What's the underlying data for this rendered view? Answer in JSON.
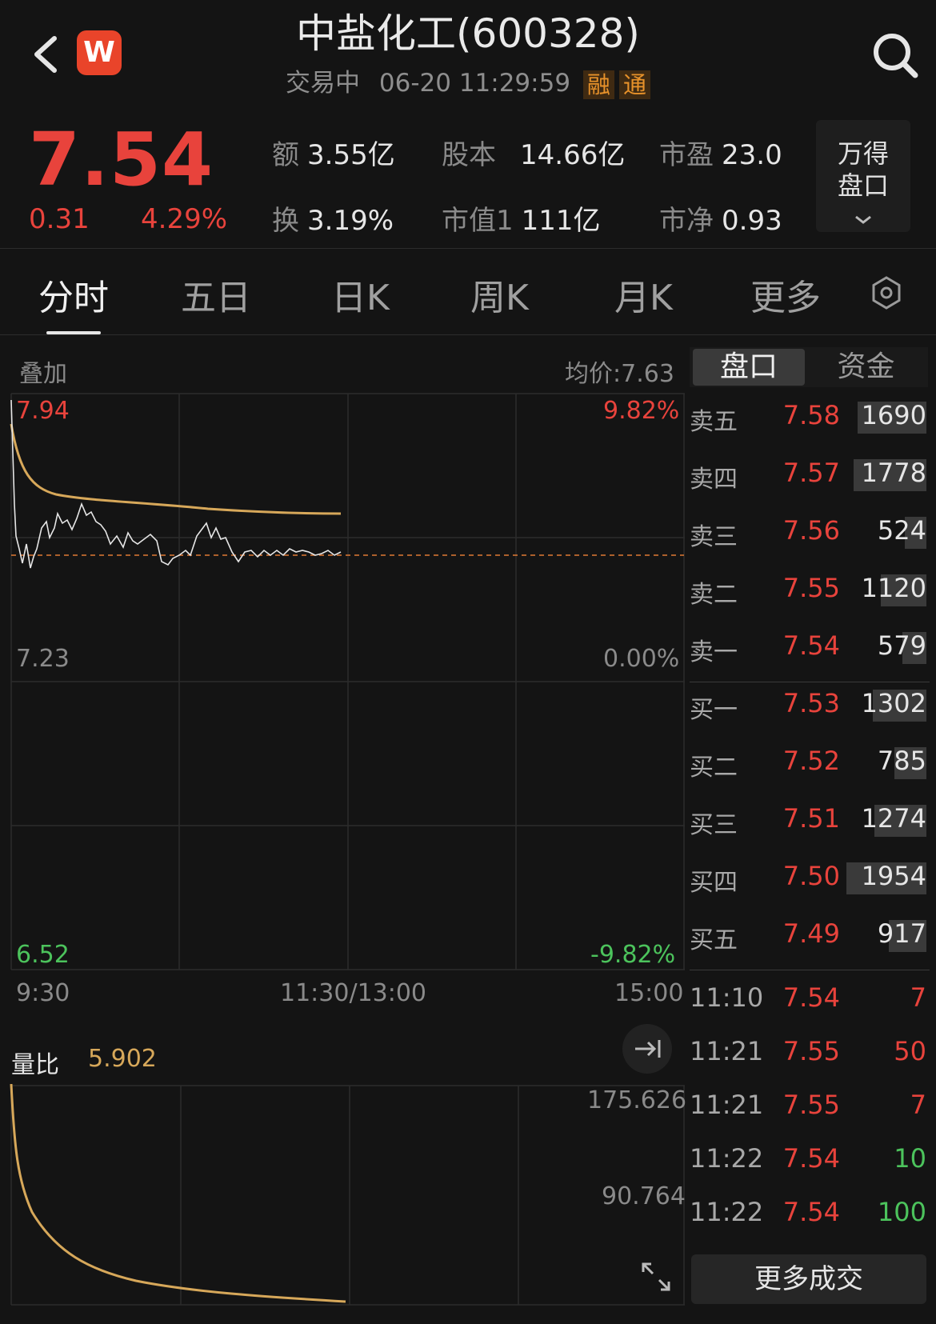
{
  "header": {
    "title": "中盐化工(600328)",
    "status": "交易中",
    "datetime": "06-20 11:29:59",
    "badge_rong": "融",
    "badge_tong": "通",
    "logo_letter": "W"
  },
  "quote": {
    "price": "7.54",
    "change": "0.31",
    "change_pct": "4.29%",
    "stats": [
      {
        "k": "额",
        "v": "3.55亿"
      },
      {
        "k": "股本",
        "v": "14.66亿"
      },
      {
        "k": "市盈",
        "v": "23.0"
      },
      {
        "k": "换",
        "v": "3.19%"
      },
      {
        "k": "市值1",
        "v": "111亿"
      },
      {
        "k": "市净",
        "v": "0.93"
      }
    ],
    "wind_button_line1": "万得",
    "wind_button_line2": "盘口"
  },
  "tabs": [
    "分时",
    "五日",
    "日K",
    "周K",
    "月K",
    "更多"
  ],
  "chart": {
    "overlay_label": "叠加",
    "avg_price_label": "均价:7.63",
    "y_high": "7.94",
    "y_mid": "7.23",
    "y_low": "6.52",
    "pct_high": "9.82%",
    "pct_mid": "0.00%",
    "pct_low": "-9.82%",
    "x_start": "9:30",
    "x_mid": "11:30/13:00",
    "x_end": "15:00",
    "volume_ratio_label": "量比",
    "volume_ratio_value": "5.902",
    "vol_axis_high": "175.626",
    "vol_axis_mid": "90.764"
  },
  "panel": {
    "tab_pankou": "盘口",
    "tab_zijin": "资金",
    "order_book": [
      {
        "label": "卖五",
        "price": "7.58",
        "volume": "1690",
        "fill": 0.86
      },
      {
        "label": "卖四",
        "price": "7.57",
        "volume": "1778",
        "fill": 0.91
      },
      {
        "label": "卖三",
        "price": "7.56",
        "volume": "524",
        "fill": 0.27
      },
      {
        "label": "卖二",
        "price": "7.55",
        "volume": "1120",
        "fill": 0.57
      },
      {
        "label": "卖一",
        "price": "7.54",
        "volume": "579",
        "fill": 0.3
      },
      {
        "label": "买一",
        "price": "7.53",
        "volume": "1302",
        "fill": 0.67
      },
      {
        "label": "买二",
        "price": "7.52",
        "volume": "785",
        "fill": 0.4
      },
      {
        "label": "买三",
        "price": "7.51",
        "volume": "1274",
        "fill": 0.65
      },
      {
        "label": "买四",
        "price": "7.50",
        "volume": "1954",
        "fill": 1.0
      },
      {
        "label": "买五",
        "price": "7.49",
        "volume": "917",
        "fill": 0.47
      }
    ],
    "trades": [
      {
        "time": "11:10",
        "price": "7.54",
        "qty": "7",
        "color": "#e8433c"
      },
      {
        "time": "11:21",
        "price": "7.55",
        "qty": "50",
        "color": "#e8433c"
      },
      {
        "time": "11:21",
        "price": "7.55",
        "qty": "7",
        "color": "#e8433c"
      },
      {
        "time": "11:22",
        "price": "7.54",
        "qty": "10",
        "color": "#4cc35c"
      },
      {
        "time": "11:22",
        "price": "7.54",
        "qty": "100",
        "color": "#4cc35c"
      }
    ],
    "more_trades": "更多成交"
  }
}
